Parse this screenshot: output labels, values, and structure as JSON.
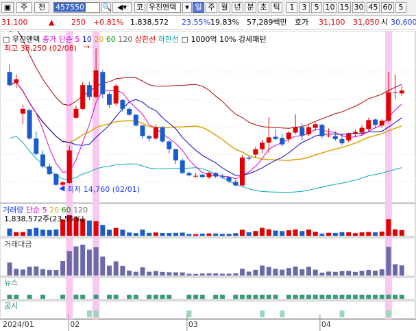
{
  "toolbar": {
    "market": "주",
    "prev": "전",
    "code": "457550",
    "market_badge": "코",
    "name": "우진엔텍",
    "periods": [
      "일",
      "주",
      "월",
      "년",
      "분",
      "초",
      "틱"
    ],
    "selected_period": "일",
    "intervals": [
      "1",
      "3",
      "5",
      "10",
      "15",
      "30",
      "45",
      "60",
      "5"
    ]
  },
  "quote": {
    "price": "31,100",
    "change": "250",
    "change_pct": "+0.81%",
    "volume": "1,838,572",
    "turnover": "23.55%",
    "ratio": "19.83%",
    "amount": "57,289백만",
    "hoga_label": "호가",
    "ask": "31,100",
    "bid": "31,050",
    "open_label": "시",
    "open": "30,600"
  },
  "main_panel": {
    "title": "우진엔텍",
    "ma_label": "종가 단순",
    "ma_periods": [
      "5",
      "10",
      "20",
      "60",
      "120"
    ],
    "upper_band": "상한선",
    "lower_band": "하한선",
    "pattern": "1000억 10% 강세패턴",
    "high_label": "최고 38,250 (02/08)",
    "low_label": "최저 14,760 (02/01)"
  },
  "volume_panel": {
    "title": "거래량",
    "ma_label": "단순",
    "ma_periods": [
      "5",
      "20",
      "60",
      "120"
    ],
    "value": "1,838,572주(23.55%)"
  },
  "amount_panel": {
    "title": "거래대금"
  },
  "news_panel": {
    "title": "뉴스"
  },
  "disclosure_panel": {
    "title": "공시"
  },
  "x_axis": {
    "labels": [
      "2024/01",
      "02",
      "03",
      "04"
    ]
  },
  "colors": {
    "up": "#e00000",
    "down": "#1a5ccc",
    "highlight": "#f9c8f0",
    "ma5": "#d400d4",
    "ma10": "#0000c8",
    "ma20": "#e0a000",
    "upper": "#b00000",
    "lower": "#00a8b8"
  },
  "chart_data": {
    "type": "candlestick",
    "dates": [
      "01/22",
      "01/23",
      "01/24",
      "01/25",
      "01/26",
      "01/29",
      "01/30",
      "01/31",
      "02/01",
      "02/02",
      "02/05",
      "02/06",
      "02/07",
      "02/08",
      "02/13",
      "02/14",
      "02/15",
      "02/16",
      "02/19",
      "02/20",
      "02/21",
      "02/22",
      "02/23",
      "02/26",
      "02/27",
      "02/28",
      "02/29",
      "03/04",
      "03/05",
      "03/06",
      "03/07",
      "03/08",
      "03/11",
      "03/12",
      "03/13",
      "03/14",
      "03/15",
      "03/18",
      "03/19",
      "03/20",
      "03/21",
      "03/22",
      "03/25",
      "03/26",
      "03/27",
      "03/28",
      "03/29",
      "04/01",
      "04/02",
      "04/03",
      "04/04",
      "04/05",
      "04/08",
      "04/09",
      "04/10",
      "04/11",
      "04/12",
      "04/15",
      "04/16",
      "04/17"
    ],
    "ohlc": [
      [
        34200,
        35500,
        31800,
        32000
      ],
      [
        32400,
        33800,
        31500,
        33000
      ],
      [
        27200,
        28700,
        25400,
        28000
      ],
      [
        27800,
        28000,
        22800,
        23000
      ],
      [
        23000,
        24200,
        20200,
        20400
      ],
      [
        20300,
        21000,
        18000,
        18300
      ],
      [
        18300,
        18800,
        16800,
        17000
      ],
      [
        17000,
        17200,
        15000,
        15200
      ],
      [
        15200,
        15800,
        14760,
        15600
      ],
      [
        15500,
        21800,
        15400,
        21000
      ],
      [
        26500,
        28500,
        26400,
        28000
      ],
      [
        28000,
        32500,
        27800,
        32000
      ],
      [
        32000,
        32600,
        29500,
        30000
      ],
      [
        30000,
        38250,
        29800,
        34500
      ],
      [
        34200,
        34600,
        29800,
        30500
      ],
      [
        30500,
        30800,
        28200,
        28700
      ],
      [
        28900,
        32200,
        28500,
        31900
      ],
      [
        29500,
        29600,
        27500,
        28000
      ],
      [
        28000,
        28300,
        26800,
        27000
      ],
      [
        27000,
        27200,
        25000,
        25200
      ],
      [
        25200,
        25300,
        23000,
        23400
      ],
      [
        23400,
        23600,
        22500,
        23000
      ],
      [
        23000,
        25400,
        22800,
        24900
      ],
      [
        24900,
        25100,
        22200,
        22500
      ],
      [
        22500,
        22700,
        20500,
        21200
      ],
      [
        21200,
        21300,
        18700,
        19300
      ],
      [
        19300,
        19600,
        17000,
        17200
      ],
      [
        17200,
        17400,
        16600,
        16800
      ],
      [
        16600,
        17200,
        16400,
        16700
      ],
      [
        16900,
        17000,
        16400,
        16500
      ],
      [
        16500,
        17400,
        16200,
        17200
      ],
      [
        17200,
        17300,
        16300,
        16600
      ],
      [
        16600,
        17000,
        16200,
        16500
      ],
      [
        16500,
        16700,
        15500,
        15800
      ],
      [
        15700,
        16000,
        14900,
        15100
      ],
      [
        15100,
        20200,
        15000,
        19800
      ],
      [
        19800,
        20100,
        19300,
        19600
      ],
      [
        20300,
        21600,
        19800,
        21200
      ],
      [
        21200,
        22800,
        20500,
        22300
      ],
      [
        22300,
        26600,
        20600,
        23200
      ],
      [
        23300,
        24600,
        22700,
        22900
      ],
      [
        23100,
        23800,
        21700,
        22000
      ],
      [
        22900,
        24200,
        22400,
        24000
      ],
      [
        24000,
        27100,
        23700,
        24900
      ],
      [
        24900,
        25500,
        22600,
        23500
      ],
      [
        23700,
        25200,
        23400,
        24900
      ],
      [
        24800,
        25700,
        24300,
        25400
      ],
      [
        25300,
        25500,
        23000,
        23400
      ],
      [
        23400,
        24700,
        23200,
        23500
      ],
      [
        23400,
        24200,
        22600,
        22900
      ],
      [
        22900,
        23600,
        21900,
        22200
      ],
      [
        22700,
        24000,
        22400,
        23800
      ],
      [
        23800,
        24500,
        23200,
        24100
      ],
      [
        24000,
        25300,
        23500,
        24800
      ],
      [
        24600,
        26500,
        24300,
        26100
      ],
      [
        26200,
        26400,
        24700,
        25300
      ],
      [
        25200,
        26300,
        24800,
        26000
      ],
      [
        26000,
        34200,
        25700,
        30800
      ],
      [
        30800,
        33800,
        29600,
        30850
      ],
      [
        30600,
        31900,
        30200,
        31100
      ]
    ],
    "volume": [
      800,
      400,
      420,
      750,
      880,
      680,
      650,
      710,
      1820,
      2300,
      2050,
      1900,
      1700,
      1620,
      1220,
      680,
      870,
      680,
      360,
      290,
      690,
      320,
      360,
      310,
      300,
      320,
      350,
      200,
      180,
      240,
      260,
      250,
      210,
      220,
      290,
      680,
      390,
      520,
      880,
      720,
      580,
      520,
      610,
      710,
      520,
      690,
      450,
      240,
      330,
      310,
      400,
      390,
      290,
      380,
      420,
      380,
      470,
      1838,
      720,
      640
    ],
    "price_range": [
      12500,
      40000
    ],
    "highlight_dates": [
      "02/02",
      "02/08",
      "04/15"
    ],
    "news_days": [
      "01/22",
      "01/23",
      "01/25",
      "01/29",
      "02/01",
      "02/05",
      "02/06",
      "02/08",
      "02/14",
      "02/15",
      "02/19",
      "02/20",
      "02/22",
      "02/23",
      "02/26",
      "02/27",
      "03/04",
      "03/05",
      "03/06",
      "03/08",
      "03/11",
      "03/13",
      "03/14",
      "03/15",
      "03/18",
      "03/19",
      "03/20",
      "03/21",
      "03/25",
      "03/26",
      "03/27",
      "03/28",
      "03/29",
      "04/01",
      "04/02",
      "04/03",
      "04/04",
      "04/05",
      "04/08",
      "04/09",
      "04/10",
      "04/11",
      "04/12",
      "04/15",
      "04/16",
      "04/17"
    ],
    "disclosure_days": [
      "02/07",
      "02/08",
      "03/04",
      "03/19",
      "03/22",
      "04/04",
      "04/15"
    ]
  }
}
